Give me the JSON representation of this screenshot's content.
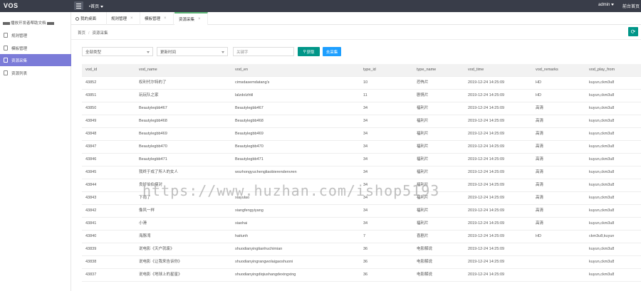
{
  "app": {
    "logo": "VOS",
    "top_select": "•首页",
    "user": "admin",
    "home_link": "前台首页"
  },
  "sidebar": {
    "header": "播放开发者帮助文档",
    "items": [
      {
        "label": "规则管理"
      },
      {
        "label": "模板管理"
      },
      {
        "label": "资源采集"
      },
      {
        "label": "资源列表"
      }
    ]
  },
  "tabs": [
    {
      "label": "我的桌面"
    },
    {
      "label": "规则管理"
    },
    {
      "label": "模板管理"
    },
    {
      "label": "资源采集"
    }
  ],
  "breadcrumb": {
    "home": "首页",
    "current": "资源采集"
  },
  "refresh_icon": "⟳",
  "filters": {
    "type_select": "全部类型",
    "time_select": "更新时间",
    "keyword_placeholder": "关键字",
    "search_button": "获取",
    "collect_button": "去采集"
  },
  "table": {
    "columns": [
      "vod_id",
      "vod_name",
      "vod_en",
      "type_id",
      "type_name",
      "vod_time",
      "vod_remarks",
      "vod_play_from"
    ],
    "rows": [
      [
        "43852",
        "权利代尔特的了",
        "cimsdasemdatang's",
        "10",
        "恐怖片",
        "2019-12-24 14:25:09",
        "HD",
        "kuyun,ckm3u8"
      ],
      [
        "43851",
        "玩玩队之家",
        "lalzdolzhtil",
        "11",
        "剧情片",
        "2019-12-24 14:25:09",
        "HD",
        "kuyun,ckm3u8"
      ],
      [
        "43850",
        "Beautyleqbb467",
        "Beautylegbb467",
        "34",
        "福利片",
        "2019-12-24 14:25:09",
        "高清",
        "kuyun,ckm3u8"
      ],
      [
        "43849",
        "Beautylegbb468",
        "Beautylegbb468",
        "34",
        "福利片",
        "2019-12-24 14:25:09",
        "高清",
        "kuyun,ckm3u8"
      ],
      [
        "43848",
        "Beautylegbb469",
        "Beautylegbb469",
        "34",
        "福利片",
        "2019-12-24 14:25:09",
        "高清",
        "kuyun,ckm3u8"
      ],
      [
        "43847",
        "Beautylegbb470",
        "Beautylegbb470",
        "34",
        "福利片",
        "2019-12-24 14:25:09",
        "高清",
        "kuyun,ckm3u8"
      ],
      [
        "43846",
        "Beautylegbb471",
        "Beautylegbb471",
        "34",
        "福利片",
        "2019-12-24 14:25:09",
        "高清",
        "kuyun,ckm3u8"
      ],
      [
        "43845",
        "我终于成了所人的女人",
        "wozhongyuchengliaobierendenvren",
        "34",
        "福利片",
        "2019-12-24 14:25:09",
        "高清",
        "kuyun,ckm3u8"
      ],
      [
        "43844",
        "良好伯伯瘦对",
        "",
        "34",
        "福利片",
        "2019-12-24 14:25:09",
        "高清",
        "kuyun,ckm3u8"
      ],
      [
        "43843",
        "下雨了",
        "xiayulao",
        "34",
        "福利片",
        "2019-12-24 14:25:09",
        "高清",
        "kuyun,ckm3u8"
      ],
      [
        "43842",
        "像风一样",
        "xiangfengyiyang",
        "34",
        "福利片",
        "2019-12-24 14:25:09",
        "高清",
        "kuyun,ckm3u8"
      ],
      [
        "43841",
        "小滑",
        "xiaohai",
        "34",
        "福利片",
        "2019-12-24 14:25:09",
        "高清",
        "kuyun,ckm3u8"
      ],
      [
        "43840",
        "海豚湾",
        "haitunh",
        "7",
        "喜剧片",
        "2019-12-24 14:25:09",
        "HD",
        "ckm3u8,kuyun"
      ],
      [
        "43839",
        "说电影《天户就废》",
        "shuodianyingtianhuchimian",
        "36",
        "电影解说",
        "2019-12-24 14:25:09",
        "",
        "kuyun,ckm3u8"
      ],
      [
        "43838",
        "说电影《让我来告诉你》",
        "shuodianyingrangwolaigaoshuoni",
        "36",
        "电影解说",
        "2019-12-24 14:25:09",
        "",
        "kuyun,ckm3u8"
      ],
      [
        "43837",
        "说电影《地球上的星星》",
        "shuodianyingdiqiushangdexingxing",
        "36",
        "电影解说",
        "2019-12-24 14:25:09",
        "",
        "kuyun,ckm3u8"
      ]
    ]
  },
  "watermark": "https://www.huzhan.com/ishop5193",
  "colors": {
    "topbar": "#393d49",
    "active_sidebar": "#7b7bd8",
    "green": "#009688",
    "blue": "#1e9fff"
  }
}
